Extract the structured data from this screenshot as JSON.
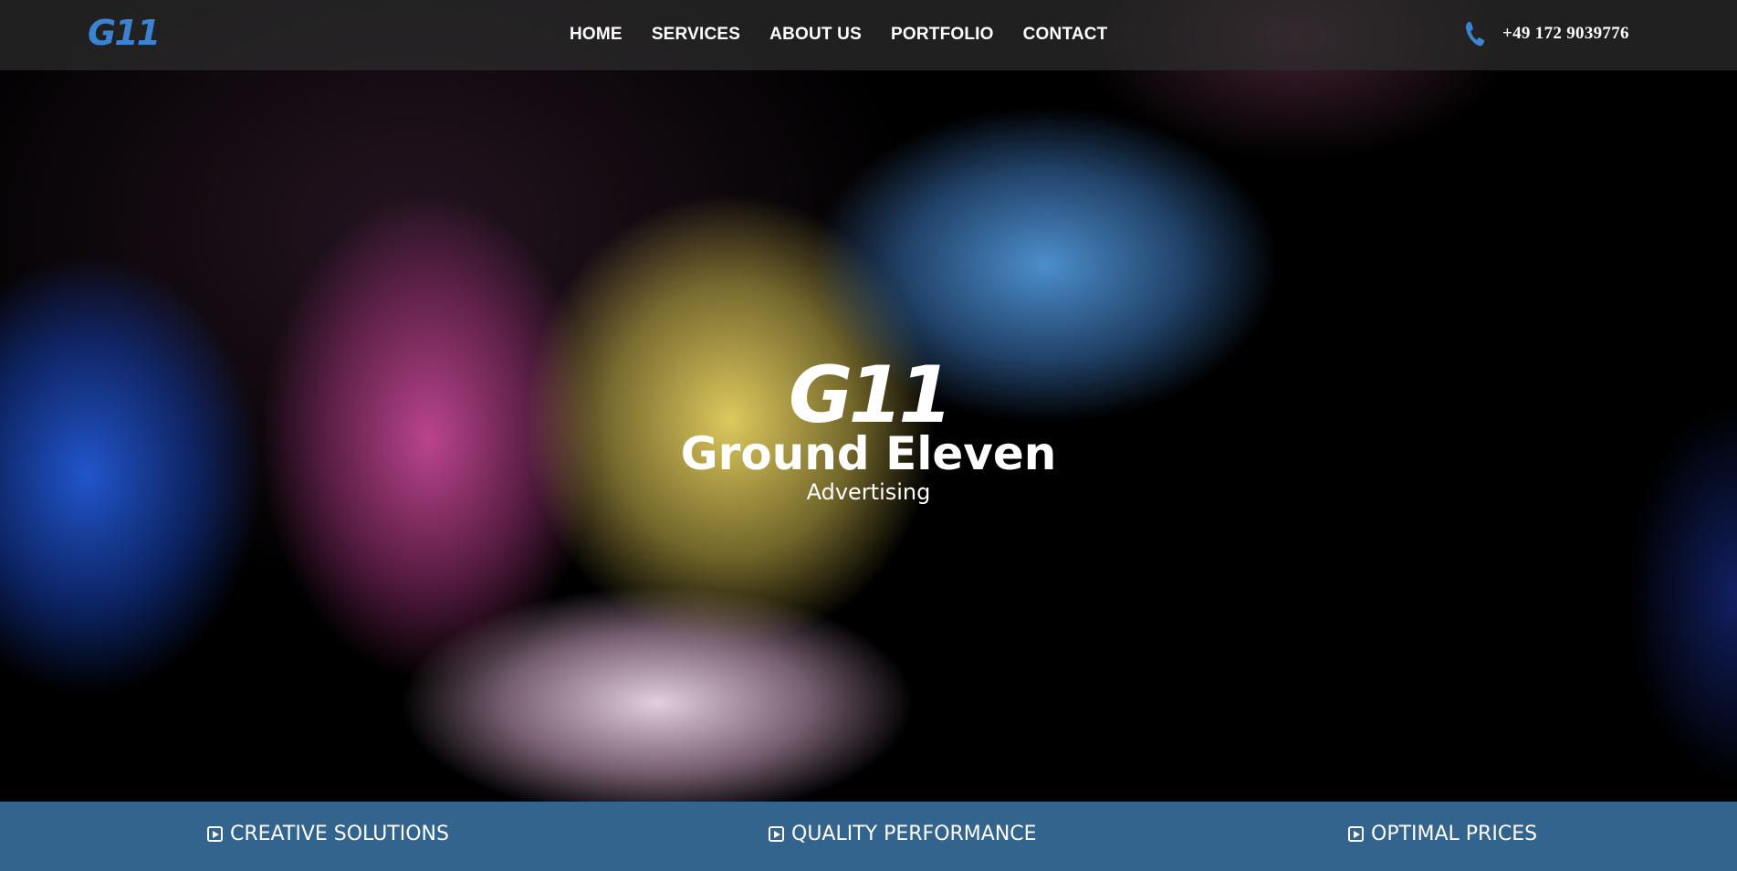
{
  "header": {
    "logo": "G11",
    "nav": [
      {
        "label": "HOME"
      },
      {
        "label": "SERVICES"
      },
      {
        "label": "ABOUT US"
      },
      {
        "label": "PORTFOLIO"
      },
      {
        "label": "CONTACT"
      }
    ],
    "phone": "+49 172 9039776",
    "phone_icon": "phone-icon"
  },
  "hero": {
    "logo": "G11",
    "title": "Ground Eleven",
    "subtitle": "Advertising"
  },
  "features": [
    {
      "label": "CREATIVE SOLUTIONS",
      "icon": "play-square-icon"
    },
    {
      "label": "QUALITY PERFORMANCE",
      "icon": "play-square-icon"
    },
    {
      "label": "OPTIMAL PRICES",
      "icon": "play-square-icon"
    }
  ],
  "colors": {
    "accent": "#3b82d0",
    "bottom_bar": "#33648e",
    "topbar": "#2d2d2d"
  }
}
